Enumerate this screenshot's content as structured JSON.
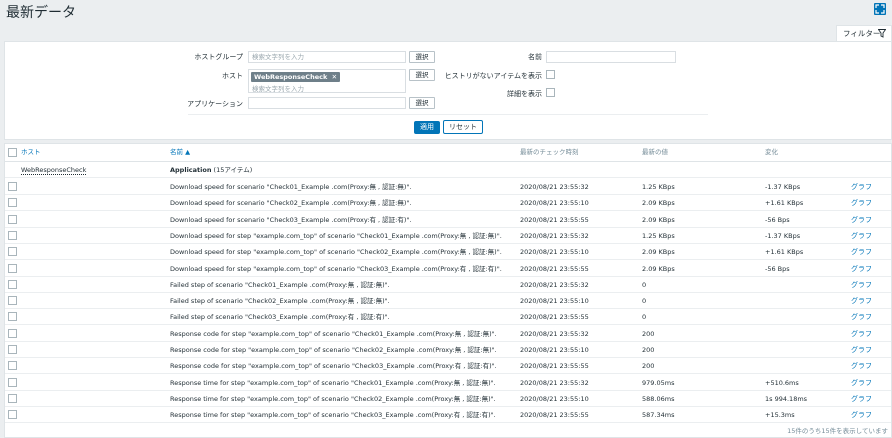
{
  "page": {
    "title": "最新データ",
    "fullscreen_icon": "fullscreen-icon"
  },
  "filter": {
    "tab_label": "フィルター",
    "host_group_label": "ホストグループ",
    "host_group_placeholder": "検索文字列を入力",
    "select_label": "選択",
    "host_label": "ホスト",
    "host_tag": "WebResponseCheck",
    "host_placeholder": "検索文字列を入力",
    "application_label": "アプリケーション",
    "application_value": "",
    "name_label": "名前",
    "name_value": "",
    "no_history_label": "ヒストリがないアイテムを表示",
    "show_details_label": "詳細を表示",
    "apply_label": "適用",
    "reset_label": "リセット"
  },
  "table": {
    "headers": {
      "host": "ホスト",
      "name": "名前 ▲",
      "last_check": "最新のチェック時刻",
      "last_value": "最新の値",
      "change": "変化"
    },
    "group_host": "WebResponseCheck",
    "group_app": "Application",
    "group_count": "(15アイテム)",
    "graph_label": "グラフ",
    "rows": [
      {
        "name": "Download speed for scenario \"Check01_Example .com(Proxy:無 , 認証:無)\".",
        "time": "2020/08/21 23:55:32",
        "value": "1.25 KBps",
        "change": "-1.37 KBps"
      },
      {
        "name": "Download speed for scenario \"Check02_Example .com(Proxy:無 , 認証:無)\".",
        "time": "2020/08/21 23:55:10",
        "value": "2.09 KBps",
        "change": "+1.61 KBps"
      },
      {
        "name": "Download speed for scenario \"Check03_Example .com(Proxy:有 , 認証:有)\".",
        "time": "2020/08/21 23:55:55",
        "value": "2.09 KBps",
        "change": "-56 Bps"
      },
      {
        "name": "Download speed for step \"example.com_top\" of scenario \"Check01_Example .com(Proxy:無 , 認証:無)\".",
        "time": "2020/08/21 23:55:32",
        "value": "1.25 KBps",
        "change": "-1.37 KBps"
      },
      {
        "name": "Download speed for step \"example.com_top\" of scenario \"Check02_Example .com(Proxy:無 , 認証:無)\".",
        "time": "2020/08/21 23:55:10",
        "value": "2.09 KBps",
        "change": "+1.61 KBps"
      },
      {
        "name": "Download speed for step \"example.com_top\" of scenario \"Check03_Example .com(Proxy:有 , 認証:有)\".",
        "time": "2020/08/21 23:55:55",
        "value": "2.09 KBps",
        "change": "-56 Bps"
      },
      {
        "name": "Failed step of scenario \"Check01_Example .com(Proxy:無 , 認証:無)\".",
        "time": "2020/08/21 23:55:32",
        "value": "0",
        "change": ""
      },
      {
        "name": "Failed step of scenario \"Check02_Example .com(Proxy:無 , 認証:無)\".",
        "time": "2020/08/21 23:55:10",
        "value": "0",
        "change": ""
      },
      {
        "name": "Failed step of scenario \"Check03_Example .com(Proxy:有 , 認証:有)\".",
        "time": "2020/08/21 23:55:55",
        "value": "0",
        "change": ""
      },
      {
        "name": "Response code for step \"example.com_top\" of scenario \"Check01_Example .com(Proxy:無 , 認証:無)\".",
        "time": "2020/08/21 23:55:32",
        "value": "200",
        "change": ""
      },
      {
        "name": "Response code for step \"example.com_top\" of scenario \"Check02_Example .com(Proxy:無 , 認証:無)\".",
        "time": "2020/08/21 23:55:10",
        "value": "200",
        "change": ""
      },
      {
        "name": "Response code for step \"example.com_top\" of scenario \"Check03_Example .com(Proxy:有 , 認証:有)\".",
        "time": "2020/08/21 23:55:55",
        "value": "200",
        "change": ""
      },
      {
        "name": "Response time for step \"example.com_top\" of scenario \"Check01_Example .com(Proxy:無 , 認証:無)\".",
        "time": "2020/08/21 23:55:32",
        "value": "979.05ms",
        "change": "+510.6ms"
      },
      {
        "name": "Response time for step \"example.com_top\" of scenario \"Check02_Example .com(Proxy:無 , 認証:無)\".",
        "time": "2020/08/21 23:55:10",
        "value": "588.06ms",
        "change": "1s 994.18ms"
      },
      {
        "name": "Response time for step \"example.com_top\" of scenario \"Check03_Example .com(Proxy:有 , 認証:有)\".",
        "time": "2020/08/21 23:55:55",
        "value": "587.34ms",
        "change": "+15.3ms"
      }
    ],
    "footer": "15件のうち15件を表示しています"
  },
  "colors": {
    "accent": "#0275b8",
    "background": "#ebeef0"
  }
}
